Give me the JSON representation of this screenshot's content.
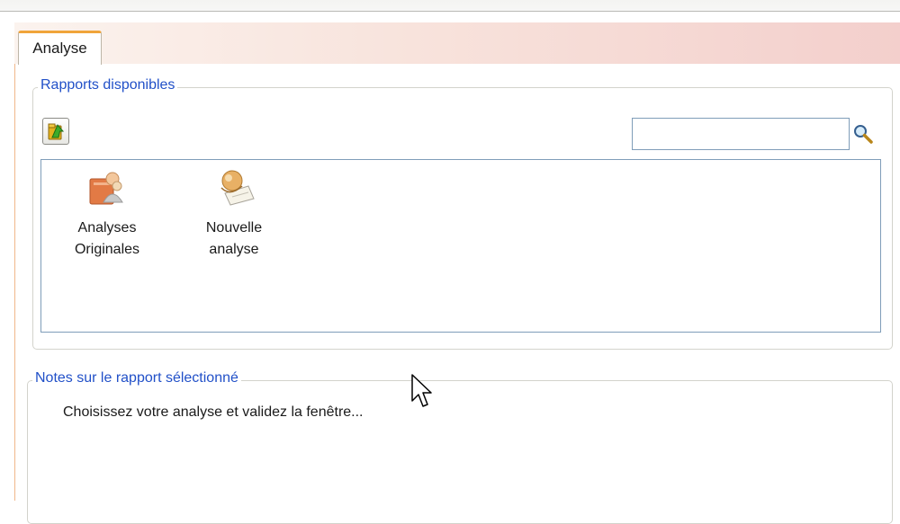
{
  "tabs": [
    {
      "label": "Analyse",
      "active": true
    }
  ],
  "rapports_group": {
    "legend": "Rapports disponibles",
    "upload_button_icon": "folder-up-arrow-icon",
    "search": {
      "value": "",
      "placeholder": ""
    },
    "items": [
      {
        "label_line1": "Analyses",
        "label_line2": "Originales",
        "icon": "report-people-icon"
      },
      {
        "label_line1": "Nouvelle",
        "label_line2": "analyse",
        "icon": "new-analysis-icon"
      }
    ]
  },
  "notes_group": {
    "legend": "Notes sur le rapport sélectionné",
    "text": "Choisissez votre analyse et validez la fenêtre..."
  },
  "colors": {
    "legend_text": "#2150c8",
    "tab_accent": "#f0a43a",
    "header_gradient_end": "#f3cfcc",
    "field_border": "#7f9db9"
  }
}
